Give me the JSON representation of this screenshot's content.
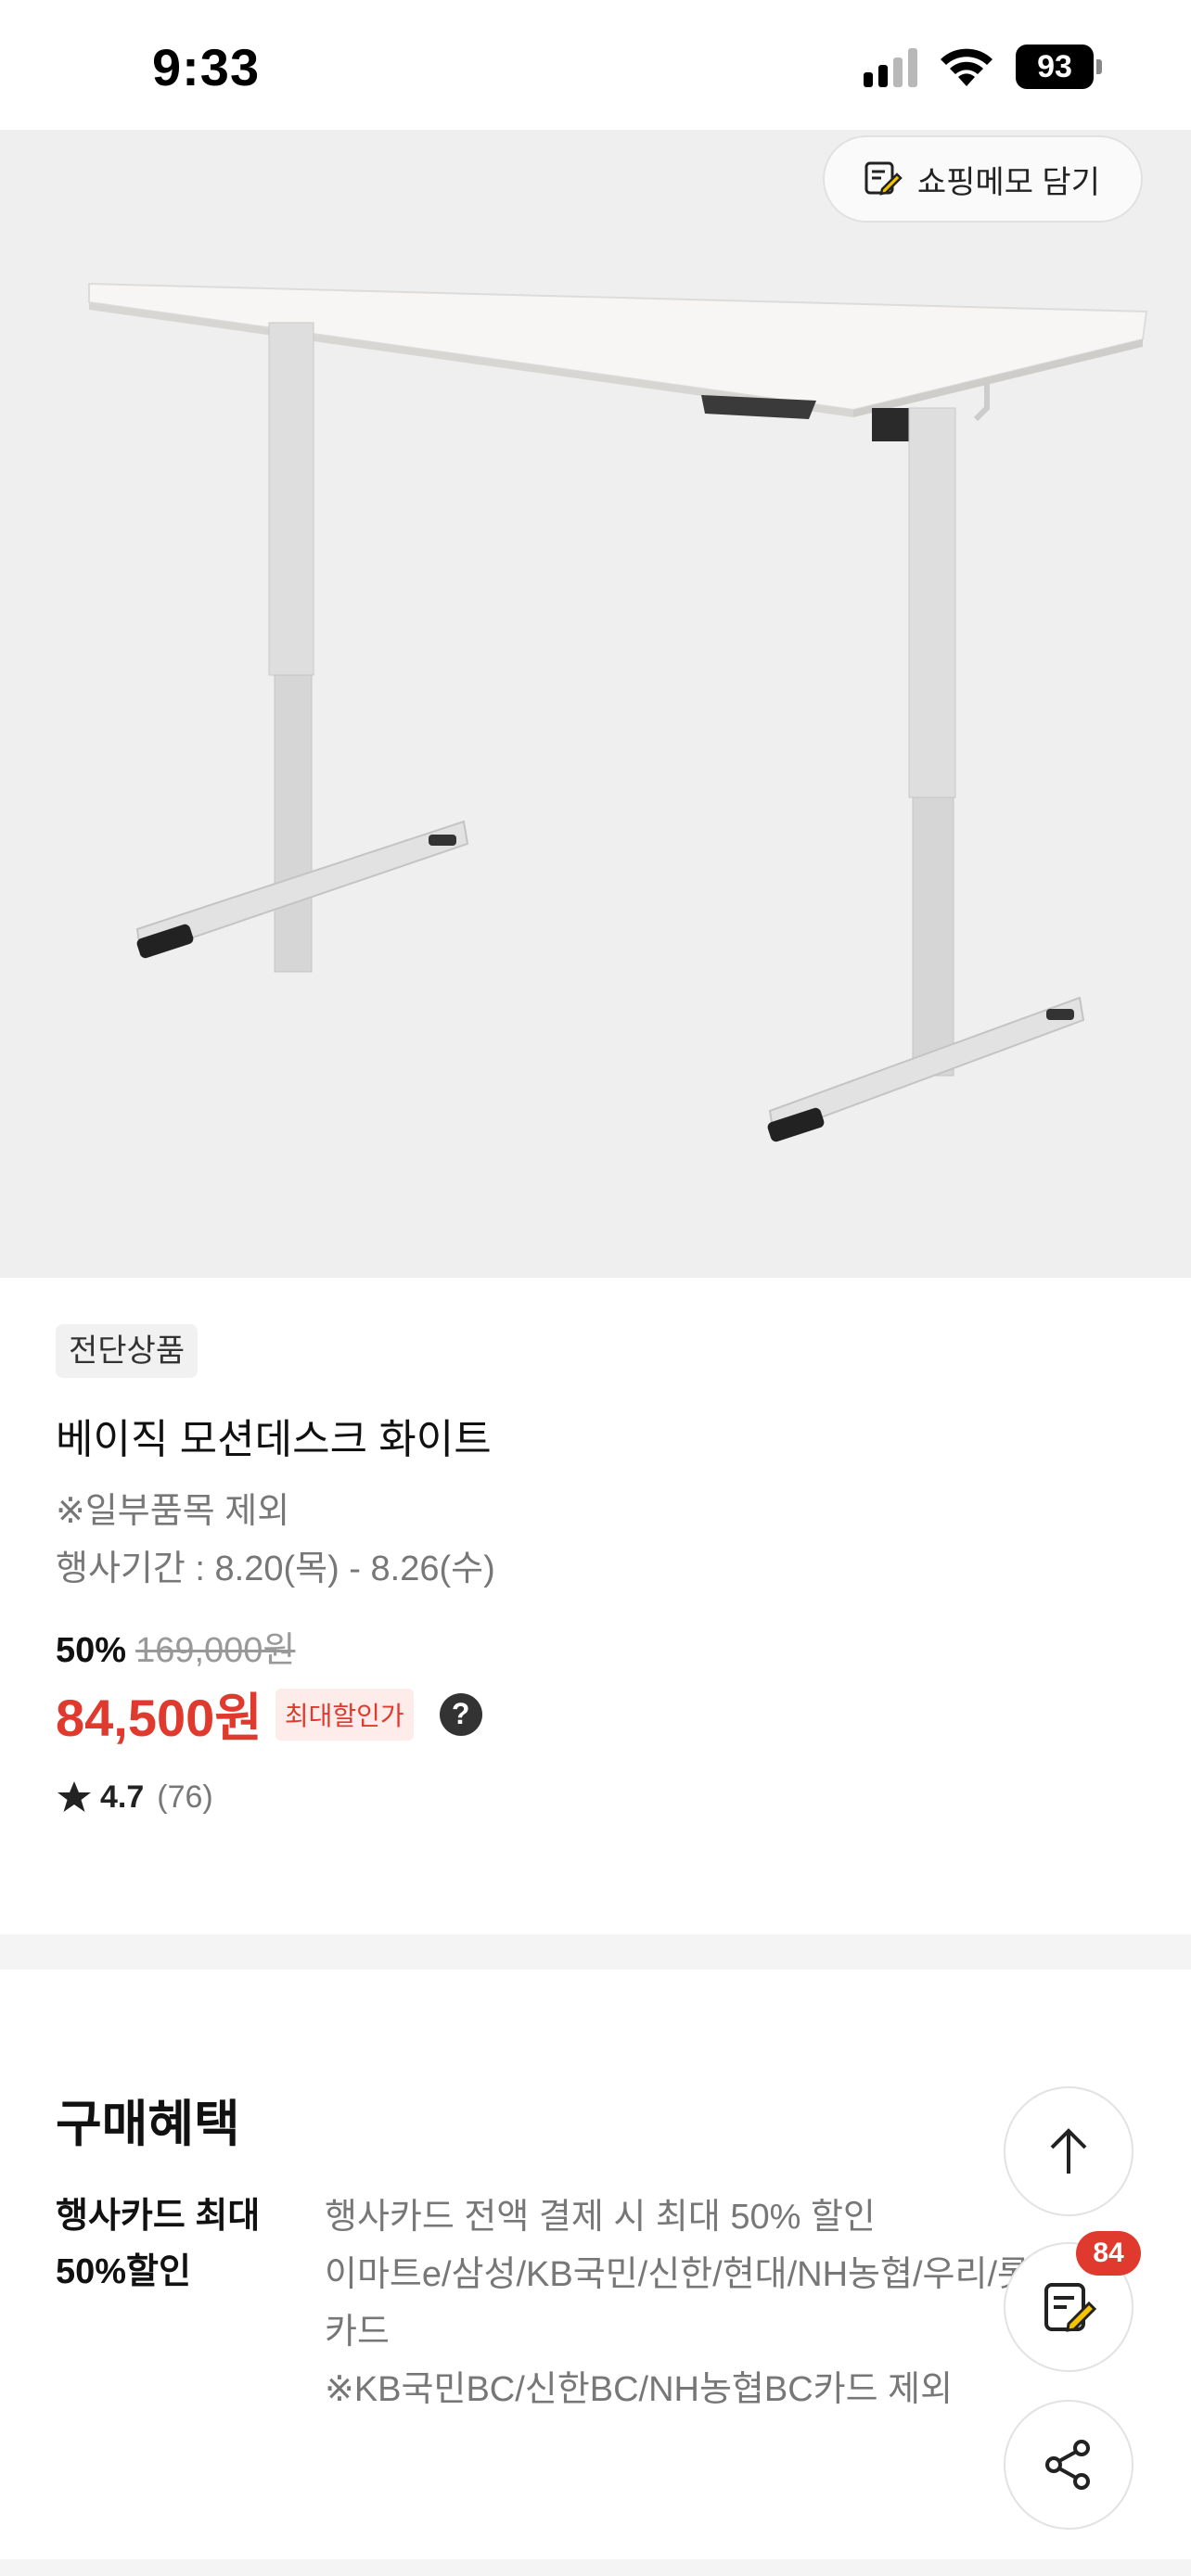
{
  "status_bar": {
    "time": "9:33",
    "battery": "93",
    "icons": [
      "signal-icon",
      "wifi-icon",
      "battery-icon"
    ]
  },
  "hero": {
    "memo_button_label": "쇼핑메모 담기",
    "memo_icon": "memo-pencil-icon",
    "image": "standing-desk-photo"
  },
  "product": {
    "badge": "전단상품",
    "title": "베이직 모션데스크 화이트",
    "note": "※일부품목 제외",
    "period": "행사기간 : 8.20(목) - 8.26(수)",
    "discount_rate": "50%",
    "original_price": "169,000원",
    "sale_price": "84,500원",
    "max_discount_badge": "최대할인가",
    "help_icon": "?",
    "rating": "4.7",
    "review_count": "(76)"
  },
  "benefits": {
    "title": "구매혜택",
    "label": "행사카드 최대 50%할인",
    "lines": [
      "행사카드 전액 결제 시 최대 50% 할인",
      "이마트e/삼성/KB국민/신한/현대/NH농협/우리/롯데",
      "카드",
      "※KB국민BC/신한BC/NH농협BC카드 제외"
    ]
  },
  "floating": {
    "memo_count": "84",
    "icons": [
      "arrow-up-icon",
      "memo-icon",
      "share-icon"
    ]
  },
  "colors": {
    "accent_red": "#e03a2e",
    "hero_bg": "#efefef"
  }
}
